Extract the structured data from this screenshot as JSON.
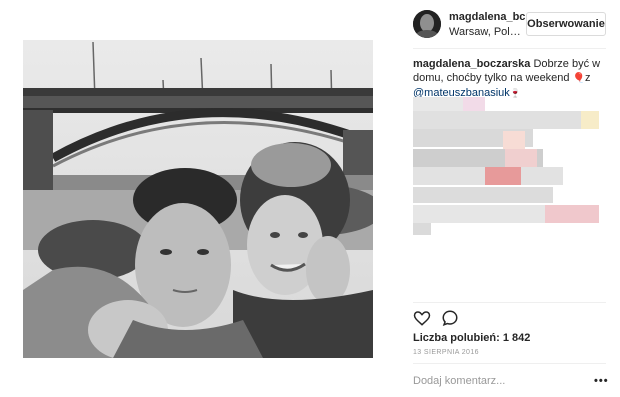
{
  "post": {
    "username": "magdalena_bc",
    "location": "Warsaw, Pol…",
    "follow_label": "Obserwowanie"
  },
  "caption": {
    "author": "magdalena_boczarska",
    "text_before": " Dobrze być w domu, choćby tylko na weekend ",
    "emoji1": "🎈",
    "text_mid": "z ",
    "mention": "@mateuszbanasiuk",
    "emoji2": "🍷"
  },
  "actions": {
    "likes_text": "Liczba polubień: 1 842",
    "date_text": "13 SIERPNIA 2016",
    "comment_placeholder": "Dodaj komentarz...",
    "more_label": "•••"
  }
}
